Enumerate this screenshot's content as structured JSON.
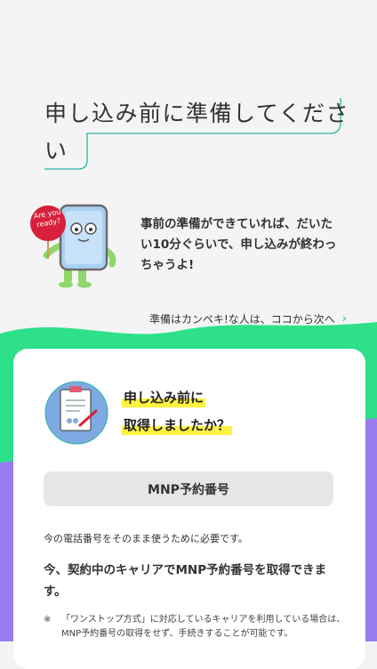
{
  "title": {
    "line1": "申し込み前に準備してくださ",
    "line2": "い"
  },
  "intro": {
    "badge_line1": "Are you",
    "badge_line2": "ready?",
    "text": "事前の準備ができていれば、だいたい10分ぐらいで、申し込みが終わっちゃうよ!"
  },
  "next_link": {
    "label": "準備はカンペキ!な人は、ココから次へ",
    "icon": "chevron-right-icon"
  },
  "card": {
    "heading_line1": "申し込み前に",
    "heading_line2": "取得しましたか？",
    "mnp_button": "MNP予約番号",
    "paragraph1": "今の電話番号をそのまま使うために必要です。",
    "paragraph2": "今、契約中のキャリアでMNP予約番号を取得できます。",
    "note_mark": "※",
    "note_text": "「ワンストップ方式」に対応しているキャリアを利用している場合は、MNP予約番号の取得をせず、手続きすることが可能です。"
  },
  "colors": {
    "green": "#2ee08a",
    "purple": "#9a7cf0",
    "accent_teal": "#2ab5a8",
    "badge_red": "#d8203c",
    "highlight_yellow": "#fff33f"
  }
}
